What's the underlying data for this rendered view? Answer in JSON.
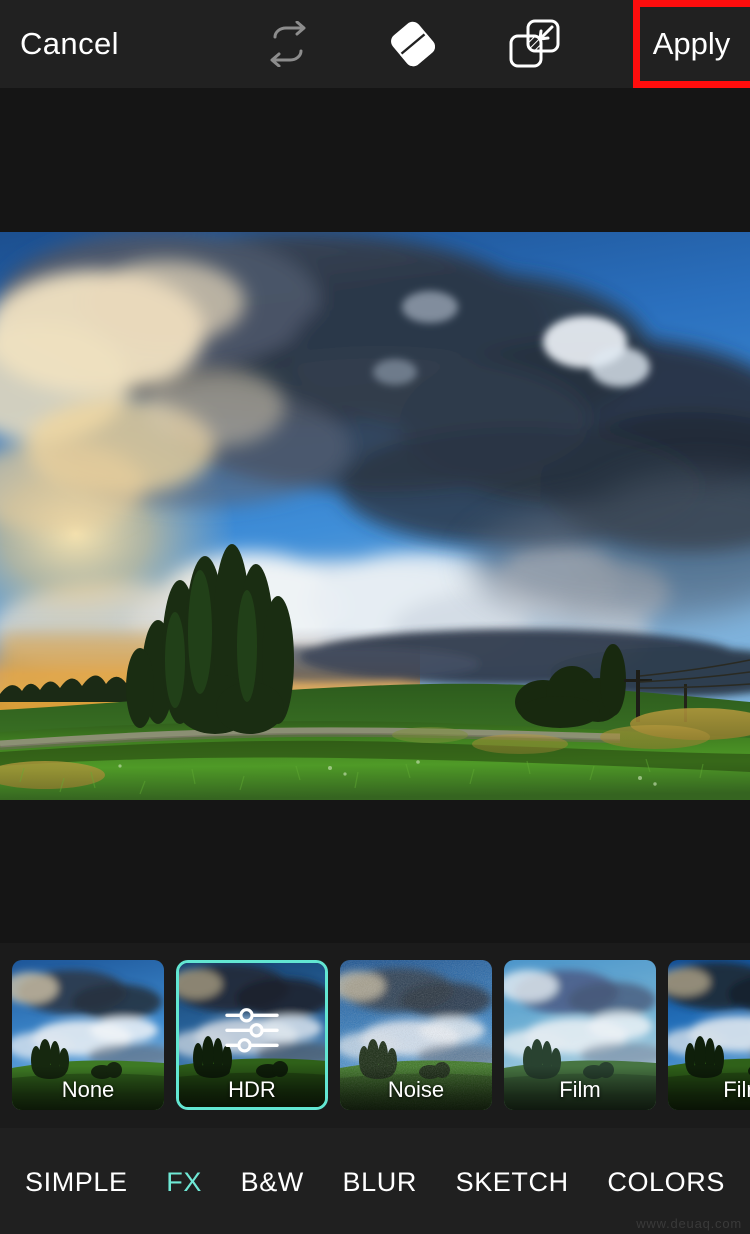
{
  "app": {
    "accent_color": "#6fe8d5",
    "highlight_color": "#ff0d0d",
    "toolbar_bg": "#212121",
    "canvas_bg": "#151515"
  },
  "toolbar": {
    "cancel_label": "Cancel",
    "apply_label": "Apply",
    "icons": [
      {
        "name": "repeat-icon",
        "state": "disabled"
      },
      {
        "name": "eraser-icon",
        "state": "active"
      },
      {
        "name": "mask-overlap-icon",
        "state": "active"
      },
      {
        "name": "check-tray-icon",
        "state": "active"
      }
    ]
  },
  "photo": {
    "description": "HDR landscape photograph of a green meadow with poplar trees under dramatic storm clouds at sunset"
  },
  "filters": {
    "items": [
      {
        "label": "None",
        "selected": false,
        "overlay_icon": ""
      },
      {
        "label": "HDR",
        "selected": true,
        "overlay_icon": "sliders-icon"
      },
      {
        "label": "Noise",
        "selected": false,
        "overlay_icon": ""
      },
      {
        "label": "Film",
        "selected": false,
        "overlay_icon": ""
      },
      {
        "label": "Film",
        "selected": false,
        "overlay_icon": ""
      }
    ]
  },
  "tabs": {
    "items": [
      {
        "label": "SIMPLE",
        "active": false
      },
      {
        "label": "FX",
        "active": true
      },
      {
        "label": "B&W",
        "active": false
      },
      {
        "label": "BLUR",
        "active": false
      },
      {
        "label": "SKETCH",
        "active": false
      },
      {
        "label": "COLORS",
        "active": false
      }
    ]
  },
  "watermark": {
    "text": "www.deuaq.com"
  }
}
